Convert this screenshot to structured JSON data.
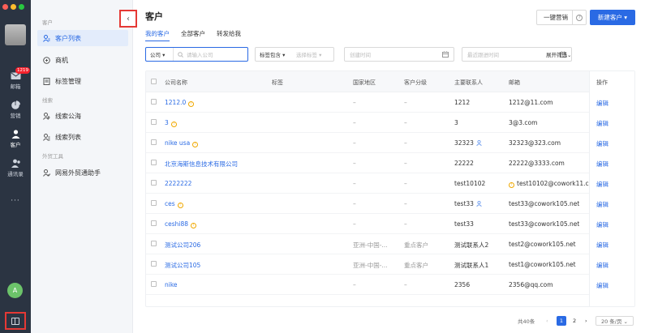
{
  "rail": {
    "items": [
      {
        "label": "邮箱",
        "icon": "mail-icon",
        "badge": "1219"
      },
      {
        "label": "营销",
        "icon": "pie-chart-icon"
      },
      {
        "label": "客户",
        "icon": "contacts-icon",
        "active": true
      },
      {
        "label": "通讯录",
        "icon": "address-book-icon"
      }
    ],
    "more": "···",
    "user_initial": "A",
    "traffic_colors": [
      "#ff5f57",
      "#febc2e",
      "#28c840"
    ]
  },
  "subnav": {
    "sections": [
      {
        "title": "客户",
        "items": [
          {
            "label": "客户列表",
            "icon": "user-list-icon",
            "active": true
          },
          {
            "label": "商机",
            "icon": "opportunity-icon"
          },
          {
            "label": "标签管理",
            "icon": "tag-manage-icon"
          }
        ]
      },
      {
        "title": "线索",
        "items": [
          {
            "label": "线索公海",
            "icon": "lead-pool-icon"
          },
          {
            "label": "线索列表",
            "icon": "lead-list-icon"
          }
        ]
      },
      {
        "title": "外贸工具",
        "items": [
          {
            "label": "网易外贸通助手",
            "icon": "assistant-icon"
          }
        ]
      }
    ],
    "collapse_glyph": "‹"
  },
  "header": {
    "title": "客户",
    "tabs": [
      {
        "label": "我的客户",
        "active": true
      },
      {
        "label": "全部客户"
      },
      {
        "label": "转发给我"
      }
    ],
    "marketing_button": "一键营销",
    "help_glyph": "?",
    "new_button": "新建客户 ▾"
  },
  "filters": {
    "company_select": "公司 ▾",
    "company_placeholder": "请输入公司",
    "tag_mode": "标签包含 ▾",
    "tag_placeholder": "选择标签 ▾",
    "created_placeholder": "创建时间",
    "contact_placeholder": "最近跟进时间",
    "expand": "展开筛选⌄"
  },
  "table": {
    "headers": [
      "公司名称",
      "标签",
      "国家地区",
      "客户分级",
      "主要联系人",
      "邮箱",
      "操作"
    ],
    "rows": [
      {
        "company": "1212.0",
        "warn": true,
        "tag": "",
        "region": "–",
        "grade": "–",
        "contact": "1212",
        "person": false,
        "email": "1212@11.com",
        "email_warn": false,
        "action": "编辑"
      },
      {
        "company": "3",
        "warn": true,
        "tag": "",
        "region": "–",
        "grade": "–",
        "contact": "3",
        "person": false,
        "email": "3@3.com",
        "email_warn": false,
        "action": "编辑"
      },
      {
        "company": "nike usa",
        "warn": true,
        "tag": "",
        "region": "–",
        "grade": "–",
        "contact": "32323",
        "person": true,
        "email": "32323@323.com",
        "email_warn": false,
        "action": "编辑"
      },
      {
        "company": "北京海斯信息技术有限公司",
        "warn": false,
        "tag": "",
        "region": "–",
        "grade": "–",
        "contact": "22222",
        "person": false,
        "email": "22222@3333.com",
        "email_warn": false,
        "action": "编辑"
      },
      {
        "company": "2222222",
        "warn": false,
        "tag": "",
        "region": "–",
        "grade": "–",
        "contact": "test10102",
        "person": false,
        "email": "test10102@cowork11.cn",
        "email_warn": true,
        "action": "编辑"
      },
      {
        "company": "ces",
        "warn": true,
        "tag": "",
        "region": "–",
        "grade": "–",
        "contact": "test33",
        "person": true,
        "email": "test33@cowork105.net",
        "email_warn": false,
        "action": "编辑"
      },
      {
        "company": "ceshi88",
        "warn": true,
        "tag": "",
        "region": "–",
        "grade": "–",
        "contact": "test33",
        "person": false,
        "email": "test33@cowork105.net",
        "email_warn": false,
        "action": "编辑"
      },
      {
        "company": "测试公司206",
        "warn": false,
        "tag": "",
        "region": "亚洲-中国-...",
        "grade": "重点客户",
        "contact": "测试联系人2",
        "person": false,
        "email": "test2@cowork105.net",
        "email_warn": false,
        "action": "编辑"
      },
      {
        "company": "测试公司105",
        "warn": false,
        "tag": "",
        "region": "亚洲-中国-...",
        "grade": "重点客户",
        "contact": "测试联系人1",
        "person": false,
        "email": "test1@cowork105.net",
        "email_warn": false,
        "action": "编辑"
      },
      {
        "company": "nike",
        "warn": false,
        "tag": "",
        "region": "–",
        "grade": "–",
        "contact": "2356",
        "person": false,
        "email": "2356@qq.com",
        "email_warn": false,
        "action": "编辑"
      }
    ]
  },
  "pagination": {
    "total": "共40条",
    "prev": "‹",
    "current": "1",
    "next_page": "2",
    "next": "›",
    "page_size": "20 条/页 ⌄"
  },
  "colors": {
    "accent": "#2a6ae4",
    "rail": "#2b3442",
    "warn": "#f0a800",
    "highlight": "#e53935"
  }
}
